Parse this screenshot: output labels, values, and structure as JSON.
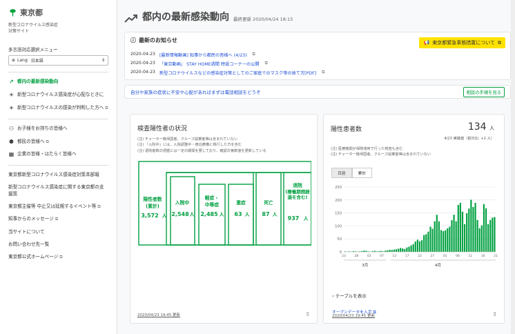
{
  "brand": {
    "logo": "東京都",
    "site_subtitle": "新型コロナウイルス感染症\n対策サイト"
  },
  "language": {
    "title": "多言語対応選択メニュー",
    "label": "Lang:",
    "selected": "日本語"
  },
  "sidebar": {
    "items": [
      {
        "label": "都内の最新感染動向",
        "icon": "trend-icon",
        "active": true,
        "external": false
      },
      {
        "label": "新型コロナウイルス感染症が心配なときに",
        "icon": "sun-icon",
        "active": false,
        "external": false
      },
      {
        "label": "新型コロナウイルスの感染が判明した方へ",
        "icon": "sun-icon",
        "active": false,
        "external": true
      },
      {
        "label": "お子様をお持ちの皆様へ",
        "icon": "family-icon",
        "active": false,
        "external": false
      },
      {
        "label": "都民の皆様へ",
        "icon": "people-icon",
        "active": false,
        "external": true
      },
      {
        "label": "企業の皆様・はたらく皆様へ",
        "icon": "building-icon",
        "active": false,
        "external": false
      }
    ],
    "links": [
      "東京都新型コロナウイルス感染症対策本部報",
      "新型コロナウイルス感染症に関する東京都の支援策",
      "東京都主催等 中止又は延期するイベント等",
      "知事からのメッセージ",
      "当サイトについて",
      "お問い合わせ先一覧",
      "東京都公式ホームページ"
    ]
  },
  "header": {
    "title": "都内の最新感染動向",
    "updated": "最終更新 2020/04/24 18:15"
  },
  "news": {
    "title": "最新のお知らせ",
    "emergency_button": "東京都緊急事態措置について",
    "items": [
      {
        "date": "2020-04-23",
        "text": "[最新情報動画] 知事から都民の皆様へ (4/23)"
      },
      {
        "date": "2020-04-23",
        "text": "「東京動画」 STAY HOME週間 特設コーナーの公開"
      },
      {
        "date": "2020-04-23",
        "text": "新型コロナウイルスなどの感染症対策としてのご家庭でのマスク等の捨て方[PDF]"
      }
    ]
  },
  "consult": {
    "text": "自分や家族の症状に不安や心配があればまずは電話相談をどうぞ",
    "button": "相談の手順を見る"
  },
  "test_card": {
    "title": "検査陽性者の状況",
    "notes": [
      "(注) チャーター機帰国者、クルーズ船乗客等は含まれていない",
      "(注) 「入院中」には、入院調整中・宿泊療養に移行した方を含む",
      "(注) 退院者数の把握には一定の期間を要しており、確認次第数値を更新している"
    ],
    "boxes": [
      {
        "label1": "陽性者数",
        "label2": "(累計)",
        "value": "3,572",
        "unit": "人"
      },
      {
        "label1": "入院中",
        "label2": "",
        "value": "2,548",
        "unit": "人"
      },
      {
        "label1": "軽症・",
        "label2": "中等症",
        "value": "2,485",
        "unit": "人"
      },
      {
        "label1": "重症",
        "label2": "",
        "value": "63",
        "unit": "人"
      },
      {
        "label1": "死亡",
        "label2": "",
        "value": "87",
        "unit": "人"
      },
      {
        "label1": "退院",
        "label2": "(療養期間経過を含む)",
        "value": "937",
        "unit": "人"
      }
    ],
    "updated": "2020/04/23 19:45 更新"
  },
  "positive_card": {
    "title": "陽性患者数",
    "count": "134",
    "unit": "人",
    "count_note": "4/23 実績値（前日比: +2 人）",
    "notes": [
      "(注) 医療機関が保険適用で行った検査も含む",
      "(注) チャーター機帰国者、クルーズ船乗客等は含まれていない"
    ],
    "tabs": [
      "日別",
      "累計"
    ],
    "table_toggle": "テーブルを表示",
    "open_data": "オープンデータを入手",
    "updated": "2020/04/23 19:45 更新"
  },
  "chart_data": {
    "type": "bar",
    "title": "陽性患者数",
    "x_ticks": [
      "23",
      "28",
      "02",
      "07",
      "12",
      "17",
      "22",
      "27",
      "01",
      "06",
      "11",
      "16",
      "21"
    ],
    "month_labels": [
      "3月",
      "4月"
    ],
    "y_ticks": [
      0,
      50,
      100,
      150,
      200,
      250
    ],
    "ylim": [
      0,
      250
    ],
    "grid": true,
    "color": "#00a040",
    "values": [
      2,
      1,
      2,
      1,
      3,
      2,
      1,
      2,
      3,
      5,
      4,
      2,
      1,
      3,
      4,
      2,
      3,
      4,
      2,
      5,
      6,
      8,
      7,
      9,
      10,
      12,
      15,
      13,
      11,
      17,
      20,
      25,
      30,
      40,
      47,
      41,
      45,
      65,
      68,
      78,
      97,
      89,
      118,
      143,
      118,
      84,
      80,
      83,
      91,
      97,
      122,
      143,
      118,
      181,
      189,
      155,
      107,
      149,
      167,
      201,
      173,
      189,
      123,
      91,
      102,
      184,
      168,
      107,
      123,
      132,
      134
    ]
  },
  "colors": {
    "accent": "#00a040",
    "link": "#1b4dd6",
    "emergency": "#ffe200"
  }
}
